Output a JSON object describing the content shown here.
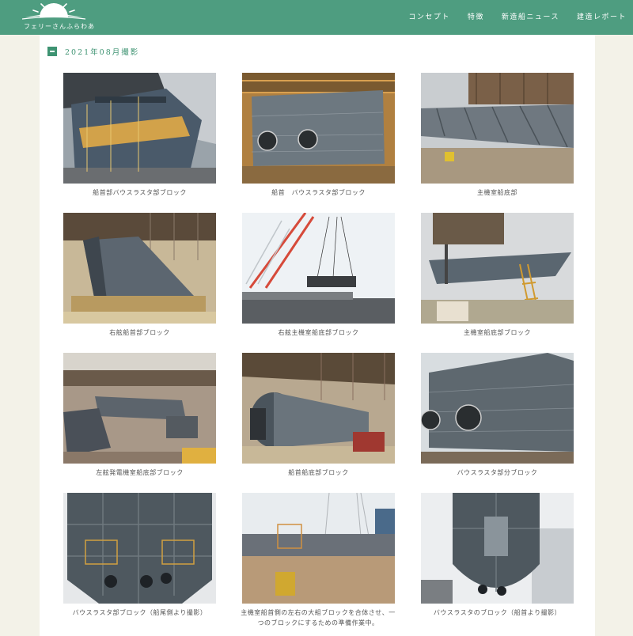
{
  "header": {
    "logo_text": "フェリーさんふらわあ",
    "nav": [
      "コンセプト",
      "特徴",
      "新造船ニュース",
      "建造レポート"
    ]
  },
  "section": {
    "title": "2021年08月撮影"
  },
  "photos": [
    {
      "caption": "船首部バウスラスタ部ブロック"
    },
    {
      "caption": "船首　バウスラスタ部ブロック"
    },
    {
      "caption": "主機室船底部"
    },
    {
      "caption": "右舷船首部ブロック"
    },
    {
      "caption": "右舷主機室船底部ブロック"
    },
    {
      "caption": "主機室船底部ブロック"
    },
    {
      "caption": "左舷発電機室船底部ブロック"
    },
    {
      "caption": "船首船底部ブロック"
    },
    {
      "caption": "バウスラスタ部分ブロック"
    },
    {
      "caption": "バウスラスタ部ブロック（船尾側より撮影）"
    },
    {
      "caption": "主機室船首側の左右の大組ブロックを合体させ、一つのブロックにするための準備作業中。"
    },
    {
      "caption": "バウスラスタのブロック（船首より撮影）"
    }
  ],
  "colors": {
    "header": "#4e9d80",
    "accent": "#3e9372",
    "page_bg": "#f3f2e8"
  }
}
